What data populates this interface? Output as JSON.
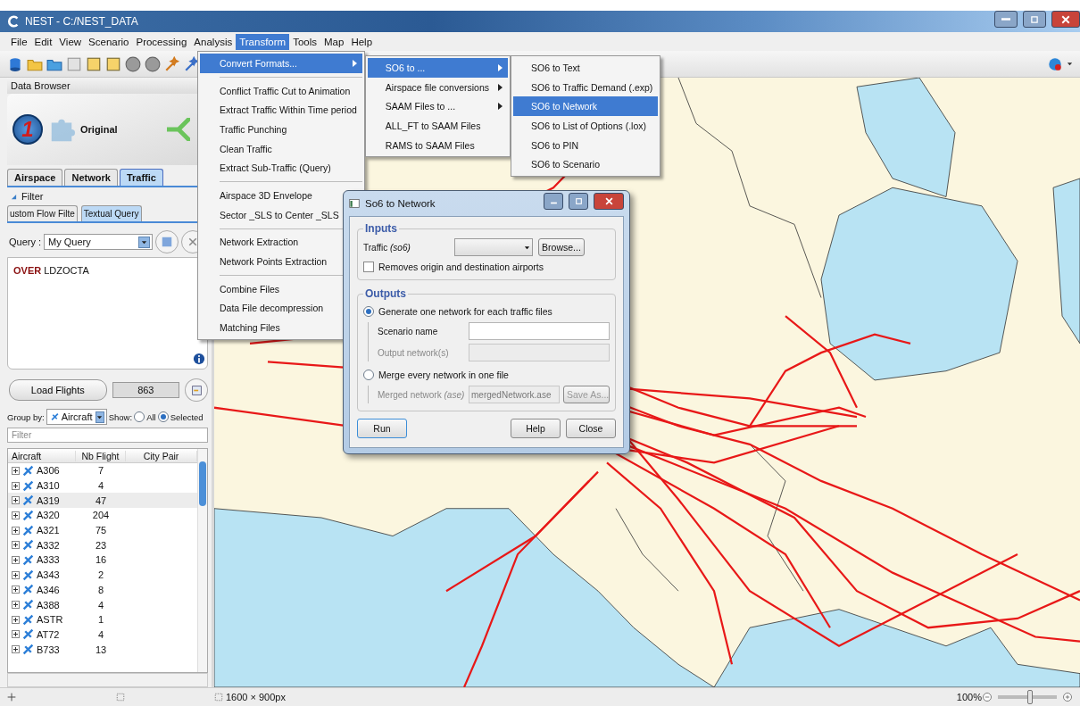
{
  "window": {
    "title": "NEST - C:/NEST_DATA"
  },
  "menu_bar": [
    {
      "label": "File",
      "selected": false
    },
    {
      "label": "Edit",
      "selected": false
    },
    {
      "label": "View",
      "selected": false
    },
    {
      "label": "Scenario",
      "selected": false
    },
    {
      "label": "Processing",
      "selected": false
    },
    {
      "label": "Analysis",
      "selected": false
    },
    {
      "label": "Transform",
      "selected": true
    },
    {
      "label": "Tools",
      "selected": false
    },
    {
      "label": "Map",
      "selected": false
    },
    {
      "label": "Help",
      "selected": false
    }
  ],
  "transform_menu": [
    {
      "kind": "item",
      "label": "Convert Formats...",
      "submenu": true,
      "selected": true
    },
    {
      "kind": "separator"
    },
    {
      "kind": "item",
      "label": "Conflict Traffic Cut to Animation",
      "submenu": false,
      "selected": false
    },
    {
      "kind": "item",
      "label": "Extract Traffic Within Time period",
      "submenu": false,
      "selected": false
    },
    {
      "kind": "item",
      "label": "Traffic Punching",
      "submenu": false,
      "selected": false
    },
    {
      "kind": "item",
      "label": "Clean Traffic",
      "submenu": false,
      "selected": false
    },
    {
      "kind": "item",
      "label": "Extract Sub-Traffic (Query)",
      "submenu": false,
      "selected": false
    },
    {
      "kind": "separator"
    },
    {
      "kind": "item",
      "label": "Airspace 3D Envelope",
      "submenu": false,
      "selected": false
    },
    {
      "kind": "item",
      "label": "Sector _SLS to Center _SLS",
      "submenu": false,
      "selected": false
    },
    {
      "kind": "separator"
    },
    {
      "kind": "item",
      "label": "Network Extraction",
      "submenu": false,
      "selected": false
    },
    {
      "kind": "item",
      "label": "Network Points Extraction",
      "submenu": false,
      "selected": false
    },
    {
      "kind": "separator"
    },
    {
      "kind": "item",
      "label": "Combine Files",
      "submenu": false,
      "selected": false
    },
    {
      "kind": "item",
      "label": "Data File decompression",
      "submenu": false,
      "selected": false
    },
    {
      "kind": "item",
      "label": "Matching Files",
      "submenu": false,
      "selected": false
    }
  ],
  "convert_submenu": [
    {
      "kind": "item",
      "label": "SO6 to ...",
      "submenu": true,
      "selected": true
    },
    {
      "kind": "item",
      "label": "Airspace file conversions",
      "submenu": true,
      "selected": false
    },
    {
      "kind": "item",
      "label": "SAAM Files to ...",
      "submenu": true,
      "selected": false
    },
    {
      "kind": "item",
      "label": "ALL_FT to SAAM Files",
      "submenu": false,
      "selected": false
    },
    {
      "kind": "item",
      "label": "RAMS to SAAM Files",
      "submenu": false,
      "selected": false
    }
  ],
  "so6_submenu": [
    {
      "kind": "item",
      "label": "SO6 to Text",
      "submenu": false,
      "selected": false
    },
    {
      "kind": "item",
      "label": "SO6 to Traffic Demand (.exp)",
      "submenu": false,
      "selected": false
    },
    {
      "kind": "item",
      "label": "SO6 to Network",
      "submenu": false,
      "selected": true
    },
    {
      "kind": "item",
      "label": "SO6 to List of Options (.lox)",
      "submenu": false,
      "selected": false
    },
    {
      "kind": "item",
      "label": "SO6 to PIN",
      "submenu": false,
      "selected": false
    },
    {
      "kind": "item",
      "label": "SO6 to Scenario",
      "submenu": false,
      "selected": false
    }
  ],
  "data_browser": {
    "title": "Data Browser",
    "banner": {
      "step": "1",
      "label": "Original"
    },
    "tabs": [
      {
        "label": "Airspace",
        "selected": false
      },
      {
        "label": "Network",
        "selected": false
      },
      {
        "label": "Traffic",
        "selected": true
      }
    ],
    "filter": {
      "title": "Filter",
      "tabs": [
        {
          "label": "ustom Flow Filte",
          "selected": false
        },
        {
          "label": "Textual Query",
          "selected": true
        }
      ],
      "query_label": "Query :",
      "query_value": "My Query",
      "query_text": "**OVER** LDZOCTA"
    },
    "load_button": "Load Flights",
    "flight_count": "863",
    "group_by_label": "Group by:",
    "group_by_value": "Aircraft",
    "show_label": "Show:",
    "show_options": [
      {
        "label": "All",
        "selected": false
      },
      {
        "label": "Selected",
        "selected": true
      }
    ],
    "filter_placeholder": "Filter",
    "table": {
      "columns": [
        "Aircraft",
        "Nb Flight",
        "City Pair"
      ],
      "rows": [
        {
          "aircraft": "A306",
          "count": "7",
          "selected": false
        },
        {
          "aircraft": "A310",
          "count": "4",
          "selected": false
        },
        {
          "aircraft": "A319",
          "count": "47",
          "selected": true
        },
        {
          "aircraft": "A320",
          "count": "204",
          "selected": false
        },
        {
          "aircraft": "A321",
          "count": "75",
          "selected": false
        },
        {
          "aircraft": "A332",
          "count": "23",
          "selected": false
        },
        {
          "aircraft": "A333",
          "count": "16",
          "selected": false
        },
        {
          "aircraft": "A343",
          "count": "2",
          "selected": false
        },
        {
          "aircraft": "A346",
          "count": "8",
          "selected": false
        },
        {
          "aircraft": "A388",
          "count": "4",
          "selected": false
        },
        {
          "aircraft": "ASTR",
          "count": "1",
          "selected": false
        },
        {
          "aircraft": "AT72",
          "count": "4",
          "selected": false
        },
        {
          "aircraft": "B733",
          "count": "13",
          "selected": false
        }
      ]
    }
  },
  "dialog": {
    "title": "So6 to Network",
    "inputs": {
      "title": "Inputs",
      "traffic_label": "Traffic *(so6)*",
      "browse_button": "Browse...",
      "checkbox": {
        "label": "Removes origin and destination airports",
        "checked": false
      }
    },
    "outputs": {
      "title": "Outputs",
      "options": [
        {
          "label": "Generate one network for each traffic files",
          "selected": true,
          "fields": [
            {
              "label": "Scenario name",
              "disabled": false
            },
            {
              "label": "Output network(s)",
              "disabled": true
            }
          ]
        },
        {
          "label": "Merge every network in one file",
          "selected": false,
          "fields": [
            {
              "label": "Merged network *(ase)*",
              "value": "mergedNetwork.ase",
              "disabled": true,
              "button": "Save As..."
            }
          ]
        }
      ]
    },
    "buttons": [
      {
        "label": "Run",
        "selected": true
      },
      {
        "label": "Help",
        "selected": false
      },
      {
        "label": "Close",
        "selected": false
      }
    ]
  },
  "status_bar": {
    "size": "1600 × 900px",
    "zoom": "100%",
    "zoom_slider": {
      "level": 0.55
    }
  }
}
